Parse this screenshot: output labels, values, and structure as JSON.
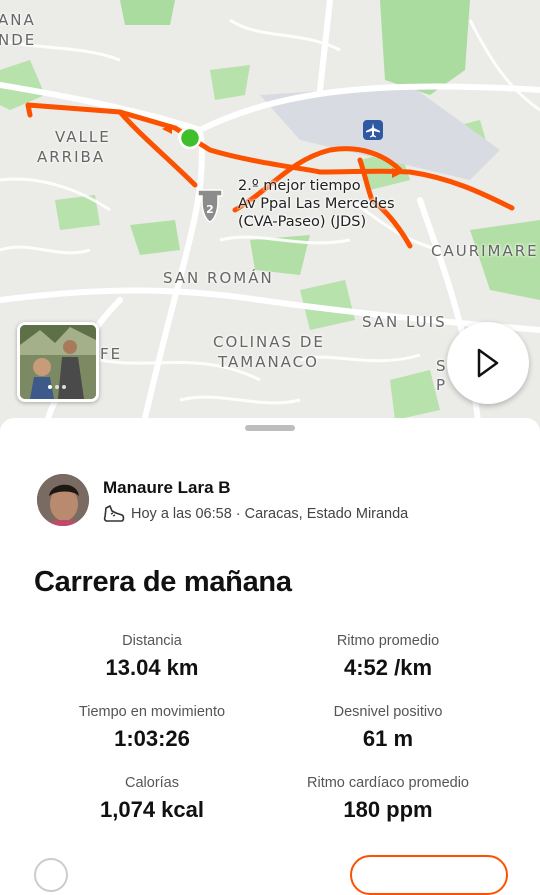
{
  "map": {
    "labels": {
      "top_left_1": "ANA",
      "top_left_2": "NDE",
      "valle_1": "VALLE",
      "valle_2": "ARRIBA",
      "san_roman": "SAN ROMÁN",
      "caurimare": "CAURIMARE",
      "san_luis": "SAN LUIS",
      "colinas_1": "COLINAS DE",
      "colinas_2": "TAMANACO",
      "fe": "FE",
      "s_edge_1": "S",
      "s_edge_2": "P"
    },
    "segment": {
      "line1": "2.º mejor tiempo",
      "line2": "Av Ppal Las Mercedes",
      "line3": "(CVA-Paseo) (JDS)",
      "badge": "2"
    },
    "route_color": "#fc5200",
    "start_color": "#3fbf2a",
    "airport_icon": "airplane-icon",
    "play_icon": "play-icon"
  },
  "activity": {
    "athlete_name": "Manaure Lara B",
    "meta": "Hoy a las 06:58 · Caracas, Estado Miranda",
    "sport_icon": "shoe-icon",
    "title": "Carrera de mañana"
  },
  "stats": [
    {
      "label": "Distancia",
      "value": "13.04 km"
    },
    {
      "label": "Ritmo promedio",
      "value": "4:52 /km"
    },
    {
      "label": "Tiempo en movimiento",
      "value": "1:03:26"
    },
    {
      "label": "Desnivel positivo",
      "value": "61 m"
    },
    {
      "label": "Calorías",
      "value": "1,074 kcal"
    },
    {
      "label": "Ritmo cardíaco promedio",
      "value": "180 ppm"
    }
  ],
  "colors": {
    "accent": "#fc5200",
    "map_bg": "#ebebe8",
    "park": "#a9dc9e"
  }
}
